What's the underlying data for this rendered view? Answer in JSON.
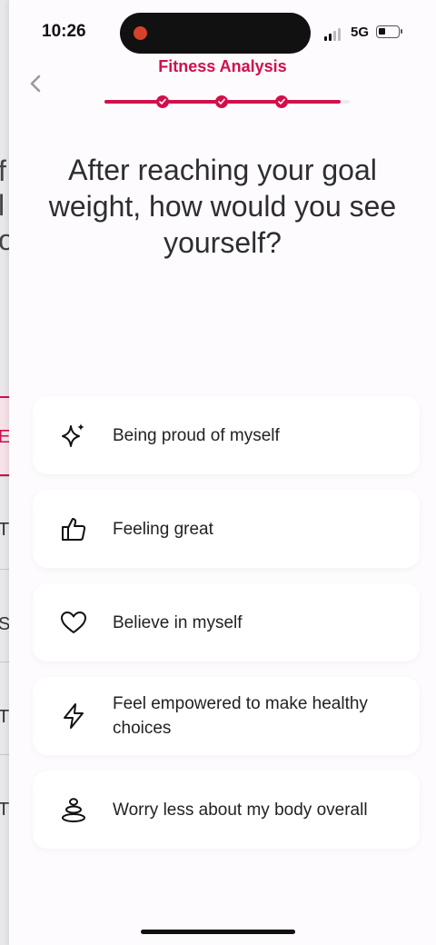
{
  "status_bar": {
    "time": "10:26",
    "network": "5G"
  },
  "header": {
    "title": "Fitness Analysis",
    "progress_steps_completed": 3,
    "progress_steps_total": 4
  },
  "question": "After reaching your goal weight, how would you see yourself?",
  "options": [
    {
      "label": "Being proud of myself",
      "icon": "sparkle-icon"
    },
    {
      "label": "Feeling great",
      "icon": "thumbs-up-icon"
    },
    {
      "label": "Believe in myself",
      "icon": "heart-icon"
    },
    {
      "label": "Feel empowered to make healthy choices",
      "icon": "lightning-icon"
    },
    {
      "label": "Worry less about my body overall",
      "icon": "stacked-stones-icon"
    }
  ],
  "colors": {
    "accent": "#d0104c",
    "background": "#fdfbfd",
    "card": "#ffffff"
  }
}
